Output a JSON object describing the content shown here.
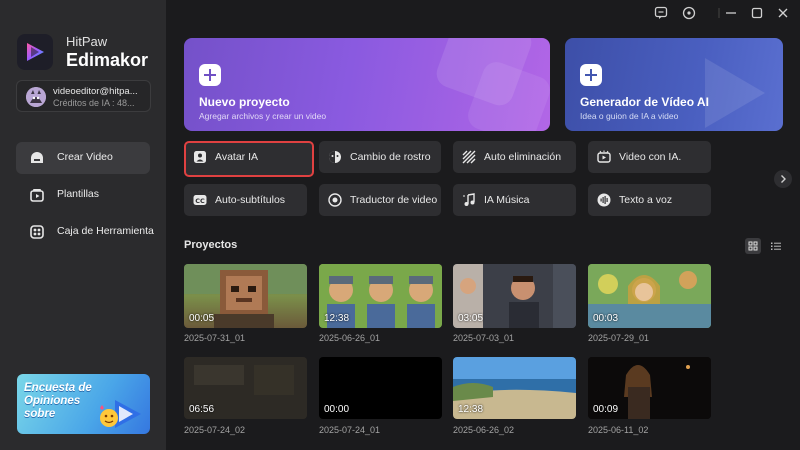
{
  "brand": {
    "line1": "HitPaw",
    "line2": "Edimakor"
  },
  "account": {
    "email": "videoeditor@hitpa...",
    "credits": "Créditos de IA : 48..."
  },
  "nav": [
    {
      "label": "Crear Video",
      "icon": "create-video-icon",
      "active": true
    },
    {
      "label": "Plantillas",
      "icon": "templates-icon",
      "active": false
    },
    {
      "label": "Caja de Herramienta",
      "icon": "toolbox-icon",
      "active": false
    }
  ],
  "survey": {
    "text": "Encuesta de Opiniones sobre"
  },
  "cards": {
    "new_project": {
      "title": "Nuevo proyecto",
      "subtitle": "Agregar archivos y crear un video"
    },
    "ai_generator": {
      "title": "Generador de Vídeo AI",
      "subtitle": "Idea o guion de IA a video"
    }
  },
  "tools": [
    {
      "label": "Avatar IA",
      "icon": "avatar-icon",
      "selected": true
    },
    {
      "label": "Cambio de rostro",
      "icon": "face-swap-icon",
      "selected": false
    },
    {
      "label": "Auto eliminación",
      "icon": "auto-remove-icon",
      "selected": false
    },
    {
      "label": "Video con IA.",
      "icon": "ai-video-icon",
      "selected": false
    },
    {
      "label": "Auto-subtítulos",
      "icon": "cc-icon",
      "selected": false
    },
    {
      "label": "Traductor de video",
      "icon": "translate-icon",
      "selected": false
    },
    {
      "label": "IA Música",
      "icon": "music-icon",
      "selected": false
    },
    {
      "label": "Texto a voz",
      "icon": "tts-icon",
      "selected": false
    }
  ],
  "projects": {
    "title": "Proyectos",
    "items": [
      {
        "duration": "00:05",
        "date": "2025-07-31_01"
      },
      {
        "duration": "12:38",
        "date": "2025-06-26_01"
      },
      {
        "duration": "03:05",
        "date": "2025-07-03_01"
      },
      {
        "duration": "00:03",
        "date": "2025-07-29_01"
      },
      {
        "duration": "06:56",
        "date": "2025-07-24_02"
      },
      {
        "duration": "00:00",
        "date": "2025-07-24_01"
      },
      {
        "duration": "12:38",
        "date": "2025-06-26_02"
      },
      {
        "duration": "00:09",
        "date": "2025-06-11_02"
      }
    ]
  },
  "colors": {
    "accent_purple": "#8a5ae0",
    "accent_blue": "#4a5fc0",
    "selected_border": "#e04141"
  }
}
